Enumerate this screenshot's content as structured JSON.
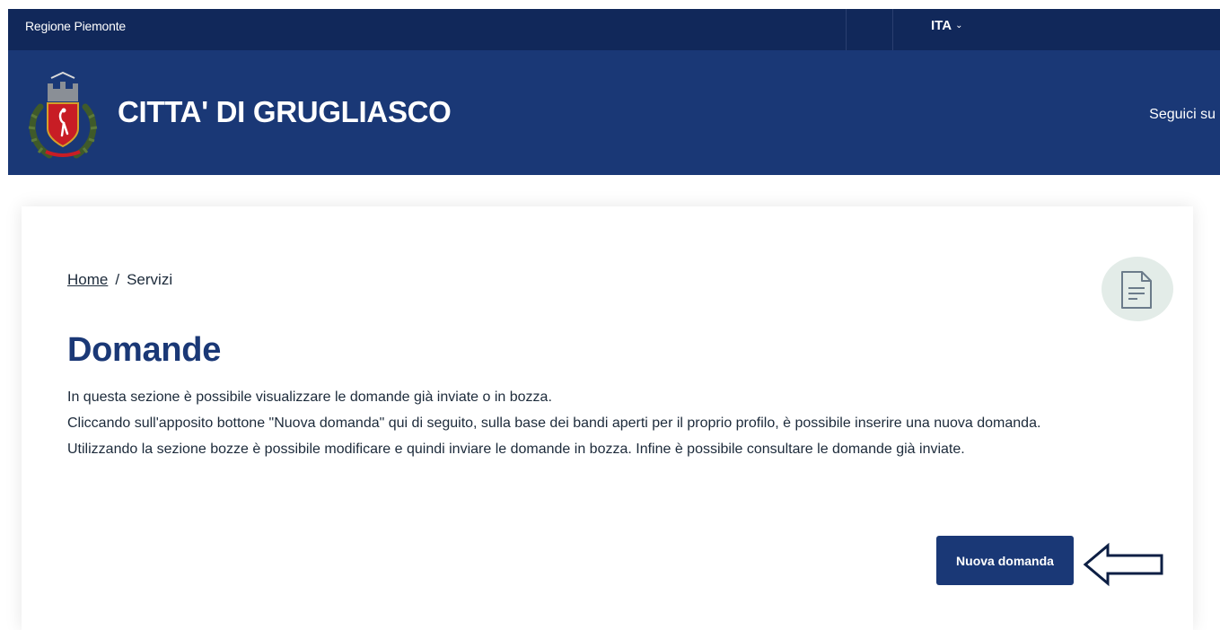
{
  "top_bar": {
    "region_label": "Regione Piemonte",
    "language": "ITA"
  },
  "header": {
    "city_name": "CITTA' DI GRUGLIASCO",
    "follow_label": "Seguici su"
  },
  "breadcrumb": {
    "home": "Home",
    "separator": "/",
    "current": "Servizi"
  },
  "main": {
    "title": "Domande",
    "intro_lines": [
      "In questa sezione è possibile visualizzare le domande già inviate o in bozza.",
      "Cliccando sull'apposito bottone \"Nuova domanda\" qui di seguito, sulla base dei bandi aperti per il proprio profilo, è possibile inserire una nuova domanda.",
      "Utilizzando la sezione bozze è possibile modificare e quindi inviare le domande in bozza. Infine è possibile consultare le domande già inviate."
    ],
    "new_button_label": "Nuova domanda"
  },
  "icons": {
    "language_dropdown": "chevron-down-icon",
    "emblem": "city-coat-of-arms-icon",
    "service": "document-icon",
    "pointer": "arrow-left-icon"
  },
  "colors": {
    "top_bar_bg": "#11285a",
    "header_bg": "#1a3876",
    "title": "#1a3876",
    "button_bg": "#1a3876",
    "badge_bg": "#e3ece8"
  }
}
